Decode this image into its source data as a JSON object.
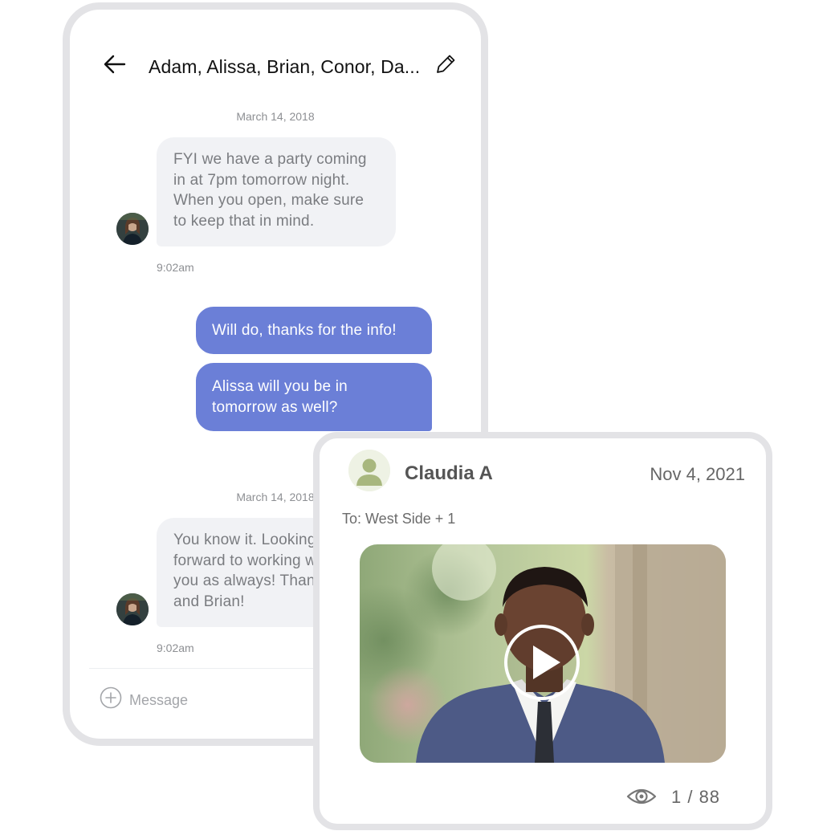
{
  "chat": {
    "title": "Adam, Alissa, Brian, Conor, Da...",
    "icons": {
      "back": "arrow-left-icon",
      "edit": "pencil-icon",
      "add": "plus-circle-icon"
    },
    "messages": [
      {
        "type": "date",
        "text": "March  14, 2018"
      },
      {
        "type": "incoming",
        "lines": [
          "FYI we have a party coming",
          "in at 7pm tomorrow night.",
          "When you open, make sure",
          "to keep that in mind."
        ],
        "time": "9:02am"
      },
      {
        "type": "outgoing",
        "lines": [
          "Will do, thanks for the info!"
        ]
      },
      {
        "type": "outgoing",
        "lines": [
          "Alissa will you be in",
          "tomorrow as well?"
        ]
      },
      {
        "type": "date",
        "text": "March  14, 2018"
      },
      {
        "type": "incoming",
        "lines": [
          "You know it.  Looking",
          "forward to working with",
          "you as always! Thanks",
          "and Brian!"
        ],
        "time": "9:02am"
      }
    ],
    "composer_placeholder": "Message"
  },
  "video_card": {
    "sender": "Claudia A",
    "date": "Nov 4, 2021",
    "recipients": "To: West Side + 1",
    "views": "1 / 88",
    "icons": {
      "avatar": "user-avatar-icon",
      "play": "play-icon",
      "views": "eye-icon"
    }
  },
  "colors": {
    "outgoing_bubble": "#6b7fd7",
    "incoming_bubble": "#f1f2f5",
    "card_border": "#e3e3e6",
    "avatar_placeholder": "#a8b77e"
  }
}
